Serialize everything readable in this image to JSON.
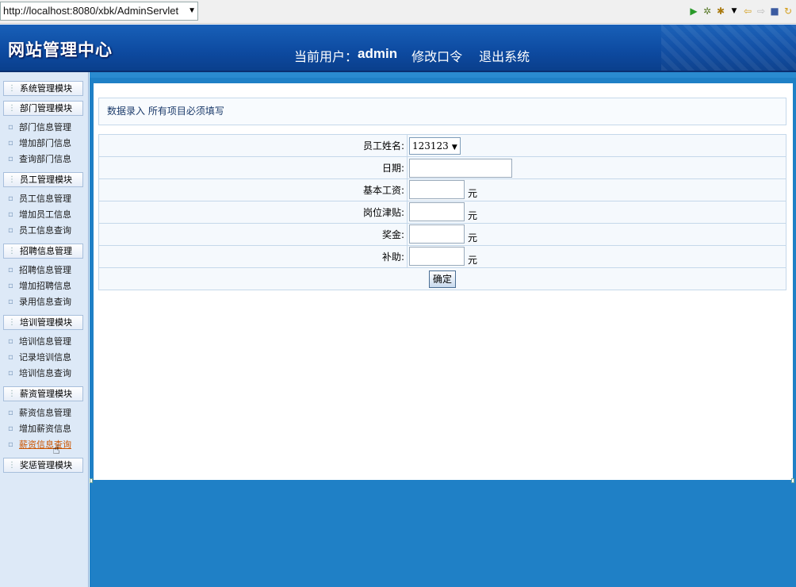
{
  "browser": {
    "url": "http://localhost:8080/xbk/AdminServlet",
    "url_dropdown": "▼",
    "toolbar_icons": [
      "run-icon",
      "debug-icon",
      "tools-icon",
      "back-icon",
      "forward-icon",
      "stop-icon",
      "refresh-icon"
    ]
  },
  "header": {
    "site_title": "网站管理中心",
    "current_user_label": "当前用户：",
    "current_user_name": "admin",
    "change_password": "修改口令",
    "logout": "退出系统"
  },
  "sidebar": {
    "modules": [
      {
        "label": "系统管理模块",
        "items": []
      },
      {
        "label": "部门管理模块",
        "items": [
          "部门信息管理",
          "增加部门信息",
          "查询部门信息"
        ]
      },
      {
        "label": "员工管理模块",
        "items": [
          "员工信息管理",
          "增加员工信息",
          "员工信息查询"
        ]
      },
      {
        "label": "招聘信息管理",
        "items": [
          "招聘信息管理",
          "增加招聘信息",
          "录用信息查询"
        ]
      },
      {
        "label": "培训管理模块",
        "items": [
          "培训信息管理",
          "记录培训信息",
          "培训信息查询"
        ]
      },
      {
        "label": "薪资管理模块",
        "items": [
          "薪资信息管理",
          "增加薪资信息",
          "薪资信息查询"
        ]
      },
      {
        "label": "奖惩管理模块",
        "items": []
      }
    ],
    "active_item": "薪资信息查询"
  },
  "main": {
    "notice": "数据录入  所有项目必须填写",
    "form": {
      "employee_name_label": "员工姓名:",
      "employee_name_value": "123123",
      "date_label": "日期:",
      "date_value": "",
      "base_salary_label": "基本工资:",
      "base_salary_value": "",
      "position_allowance_label": "岗位津贴:",
      "position_allowance_value": "",
      "bonus_label": "奖金:",
      "bonus_value": "",
      "subsidy_label": "补助:",
      "subsidy_value": "",
      "unit": "元",
      "submit_label": "确定"
    }
  },
  "colors": {
    "header_blue": "#0d4aa0",
    "main_blue": "#1f80c6",
    "sidebar_bg": "#dde9f7",
    "active_link": "#cc5500"
  }
}
